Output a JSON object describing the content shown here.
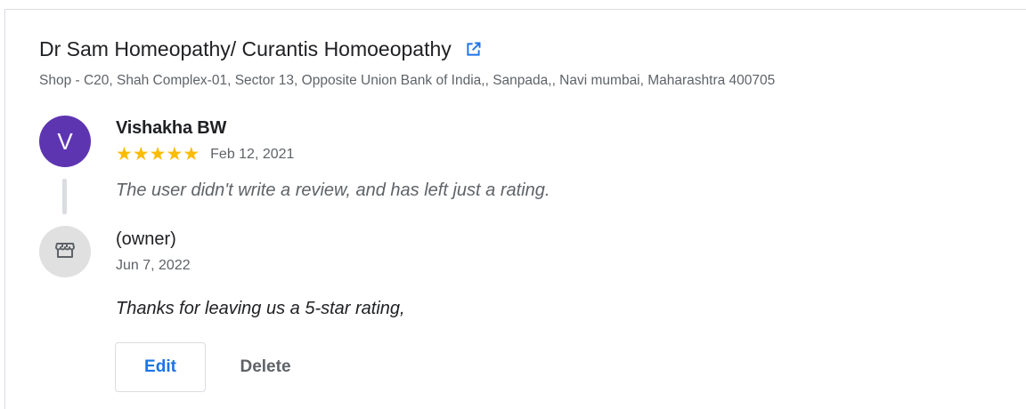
{
  "business": {
    "name": "Dr Sam Homeopathy/ Curantis Homoeopathy",
    "address": "Shop - C20, Shah Complex-01, Sector 13, Opposite Union Bank of India,, Sanpada,, Navi mumbai, Maharashtra 400705",
    "link_icon": "open-in-new-icon"
  },
  "review": {
    "avatar_letter": "V",
    "avatar_color": "#5e35b1",
    "reviewer_name": "Vishakha BW",
    "rating": 5,
    "star_color": "#fbbc04",
    "date": "Feb 12, 2021",
    "text": "The user didn't write a review, and has left just a rating."
  },
  "reply": {
    "owner_icon": "storefront-icon",
    "owner_label": "(owner)",
    "date": "Jun 7, 2022",
    "text": "Thanks for leaving us a 5-star rating,"
  },
  "actions": {
    "edit_label": "Edit",
    "delete_label": "Delete",
    "accent_color": "#1a73e8"
  }
}
